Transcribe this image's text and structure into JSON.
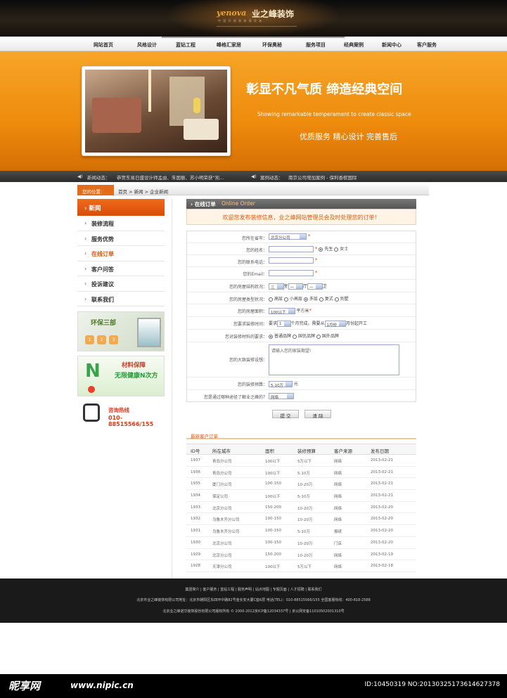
{
  "header": {
    "logo_en": "yenova",
    "logo_cn": "业之峰装饰",
    "logo_sub": "中 国 环 保 装 修 倡 导 者"
  },
  "nav": {
    "items": [
      "网站首页",
      "风格设计",
      "蓝钻工程",
      "峰格汇家居",
      "环保奥秘",
      "服务项目",
      "经典案例",
      "新闻中心",
      "客户服务"
    ]
  },
  "banner": {
    "slogan": "彰显不凡气质  缔造经典空间",
    "slogan_en": "Showing remarkable temperament to create classic space",
    "service": "优质服务   精心设计   完善售后"
  },
  "ticker": {
    "news_label": "新闻动态：",
    "news_text": "恭贺东易日盛设计师孟由、朱国振、苏小明荣获“凯...",
    "case_label": "案例动态：",
    "case_text": "南京公司增加案例 - 保利香槟国际"
  },
  "breadcrumb": {
    "tag": "您的位置：",
    "path": "首页 > 新闻 > 企业新闻"
  },
  "sidebar": {
    "title": "新闻",
    "items": [
      {
        "label": "装修流程"
      },
      {
        "label": "服务优势"
      },
      {
        "label": "在线订单"
      },
      {
        "label": "客户问答"
      },
      {
        "label": "投诉建议"
      },
      {
        "label": "联系我们"
      }
    ]
  },
  "promos": {
    "p1_title": "环保三部",
    "p1_steps": [
      "1",
      "2",
      "3"
    ],
    "p2_big": "N",
    "p2_t1": "材料保障",
    "p2_t2": "无限健康N次方",
    "p3_title": "咨询热线",
    "p3_phone": "010-88515566/155"
  },
  "order": {
    "title": "在线订单",
    "title_en": "Online Order",
    "welcome": "欢迎您发布装修信息，业之峰网站管理员会及时处理您的订单！",
    "labels": {
      "province": "您所在省市：",
      "name": "您的姓名：",
      "tel": "您的联系电话：",
      "email": "您的Email：",
      "structure": "您的房屋结构状况：",
      "type": "您的房屋类型状况：",
      "area": "您的房屋面积：",
      "time": "您要求装修时间：",
      "material": "您对装修材料的要求：",
      "idea": "您的大致装修设想：",
      "budget": "您的装修预算：",
      "source": "您是通过哪种途径了解业之峰的？"
    },
    "province_value": "北京分公司",
    "gender_male": "先生",
    "gender_female": "女士",
    "structure_opts": [
      "三",
      "室",
      "一",
      "厅",
      "一",
      "卫"
    ],
    "type_opts": [
      "高层",
      "小高层",
      "多层",
      "复式",
      "别墅"
    ],
    "area_value": "100以下",
    "area_unit": "平方米",
    "time_pre": "要求",
    "time_v1": "1",
    "time_mid": "个月完成，需要从",
    "time_v2": "1月份",
    "time_post": "月份起开工",
    "material_opts": [
      "普通品牌",
      "国优品牌",
      "国外品牌"
    ],
    "idea_value": "请输入您的家装期望!",
    "budget_value": "5-10万",
    "budget_unit": "元",
    "source_value": "网络",
    "submit": "提 交",
    "clear": "清 除"
  },
  "latest": {
    "title": "最新客户订单",
    "columns": [
      "ID号",
      "所在城市",
      "面积",
      "装修预算",
      "客户来源",
      "发布日期"
    ],
    "rows": [
      [
        "1937",
        "青岛分公司",
        "100以下",
        "5万以下",
        "网络",
        "2013-02-21"
      ],
      [
        "1936",
        "青岛分公司",
        "100以下",
        "5-10万",
        "网络",
        "2013-02-21"
      ],
      [
        "1935",
        "厦门分公司",
        "100-150",
        "10-20万",
        "网络",
        "2013-02-21"
      ],
      [
        "1934",
        "保定公司",
        "100以下",
        "5-10万",
        "网络",
        "2013-02-21"
      ],
      [
        "1933",
        "北京分公司",
        "150-200",
        "10-20万",
        "网络",
        "2013-02-20"
      ],
      [
        "1932",
        "乌鲁木齐分公司",
        "100-150",
        "10-20万",
        "网络",
        "2013-02-20"
      ],
      [
        "1931",
        "乌鲁木齐分公司",
        "100-150",
        "5-10万",
        "报纸",
        "2013-02-20"
      ],
      [
        "1930",
        "北京分公司",
        "100-150",
        "10-20万",
        "门店",
        "2013-02-20"
      ],
      [
        "1929",
        "北京分公司",
        "150-200",
        "10-20万",
        "网络",
        "2013-02-19"
      ],
      [
        "1928",
        "天津分公司",
        "100以下",
        "5万以下",
        "网络",
        "2013-02-18"
      ]
    ]
  },
  "footer": {
    "links": "集团简介  |  客户服务  |  蓝钻工程  |  服务声明  |  站点地图  |  专题页面  |  人才招聘  |  联系我们",
    "address": "北京市业之峰装饰有限公司地址：北京市朝阳区东四环中路82号金长安大厦C座6层  电话(TEL)：010-88515566/155  全国客服热线：400-818-2588",
    "copyright": "北京业之峰诺华装饰股份有限公司版权所有 © 2000-2012京ICP备12034337号 | 京公网安备11010502001310号"
  },
  "watermark": {
    "brand": "昵享网",
    "url": "www.nipic.cn",
    "id": "ID:10450319 NO:20130325173614627378"
  }
}
